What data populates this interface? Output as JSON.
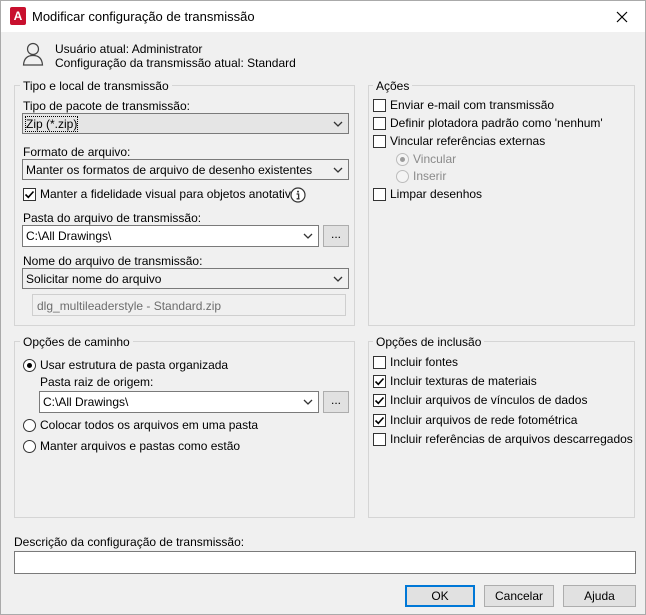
{
  "window": {
    "title": "Modificar configuração de transmissão",
    "app_icon_letter": "A"
  },
  "user_info": {
    "user_line": "Usuário atual: Administrator",
    "setup_line": "Configuração da transmissão atual: Standard"
  },
  "transmittal": {
    "group_title": "Tipo e local de transmissão",
    "package_type_label": "Tipo de pacote de transmissão:",
    "package_type_value": "Zip (*.zip)",
    "file_format_label": "Formato de arquivo:",
    "file_format_value": "Manter os formatos de arquivo de desenho existentes",
    "visual_fidelity_label": "Manter a fidelidade visual para objetos anotativos",
    "visual_fidelity_checked": true,
    "folder_label": "Pasta do arquivo de transmissão:",
    "folder_value": "C:\\All Drawings\\",
    "browse_label": "...",
    "filename_label": "Nome do arquivo de transmissão:",
    "filename_value": "Solicitar nome do arquivo",
    "preview_filename": "dlg_multileaderstyle - Standard.zip"
  },
  "actions": {
    "group_title": "Ações",
    "email_label": "Enviar e-mail com transmissão",
    "plotter_label": "Definir plotadora padrão como 'nenhum'",
    "bind_xrefs_label": "Vincular referências externas",
    "bind_option": "Vincular",
    "insert_option": "Inserir",
    "purge_label": "Limpar desenhos"
  },
  "path_options": {
    "group_title": "Opções de caminho",
    "organized_label": "Usar estrutura de pasta organizada",
    "source_root_label": "Pasta raiz de origem:",
    "source_root_value": "C:\\All Drawings\\",
    "browse_label": "...",
    "single_folder_label": "Colocar todos os arquivos em uma pasta",
    "keep_as_is_label": "Manter arquivos e pastas como estão"
  },
  "include_options": {
    "group_title": "Opções de inclusão",
    "items": [
      {
        "label": "Incluir fontes",
        "checked": false
      },
      {
        "label": "Incluir texturas de materiais",
        "checked": true
      },
      {
        "label": "Incluir arquivos de vínculos de dados",
        "checked": true
      },
      {
        "label": "Incluir arquivos de rede fotométrica",
        "checked": true
      },
      {
        "label": "Incluir referências de arquivos descarregados",
        "checked": false
      }
    ]
  },
  "description": {
    "label": "Descrição da configuração de transmissão:",
    "value": ""
  },
  "buttons": {
    "ok": "OK",
    "cancel": "Cancelar",
    "help": "Ajuda"
  },
  "colors": {
    "dialog_bg": "#f0f0f0",
    "accent": "#0078d7",
    "app_icon": "#c8102e"
  }
}
